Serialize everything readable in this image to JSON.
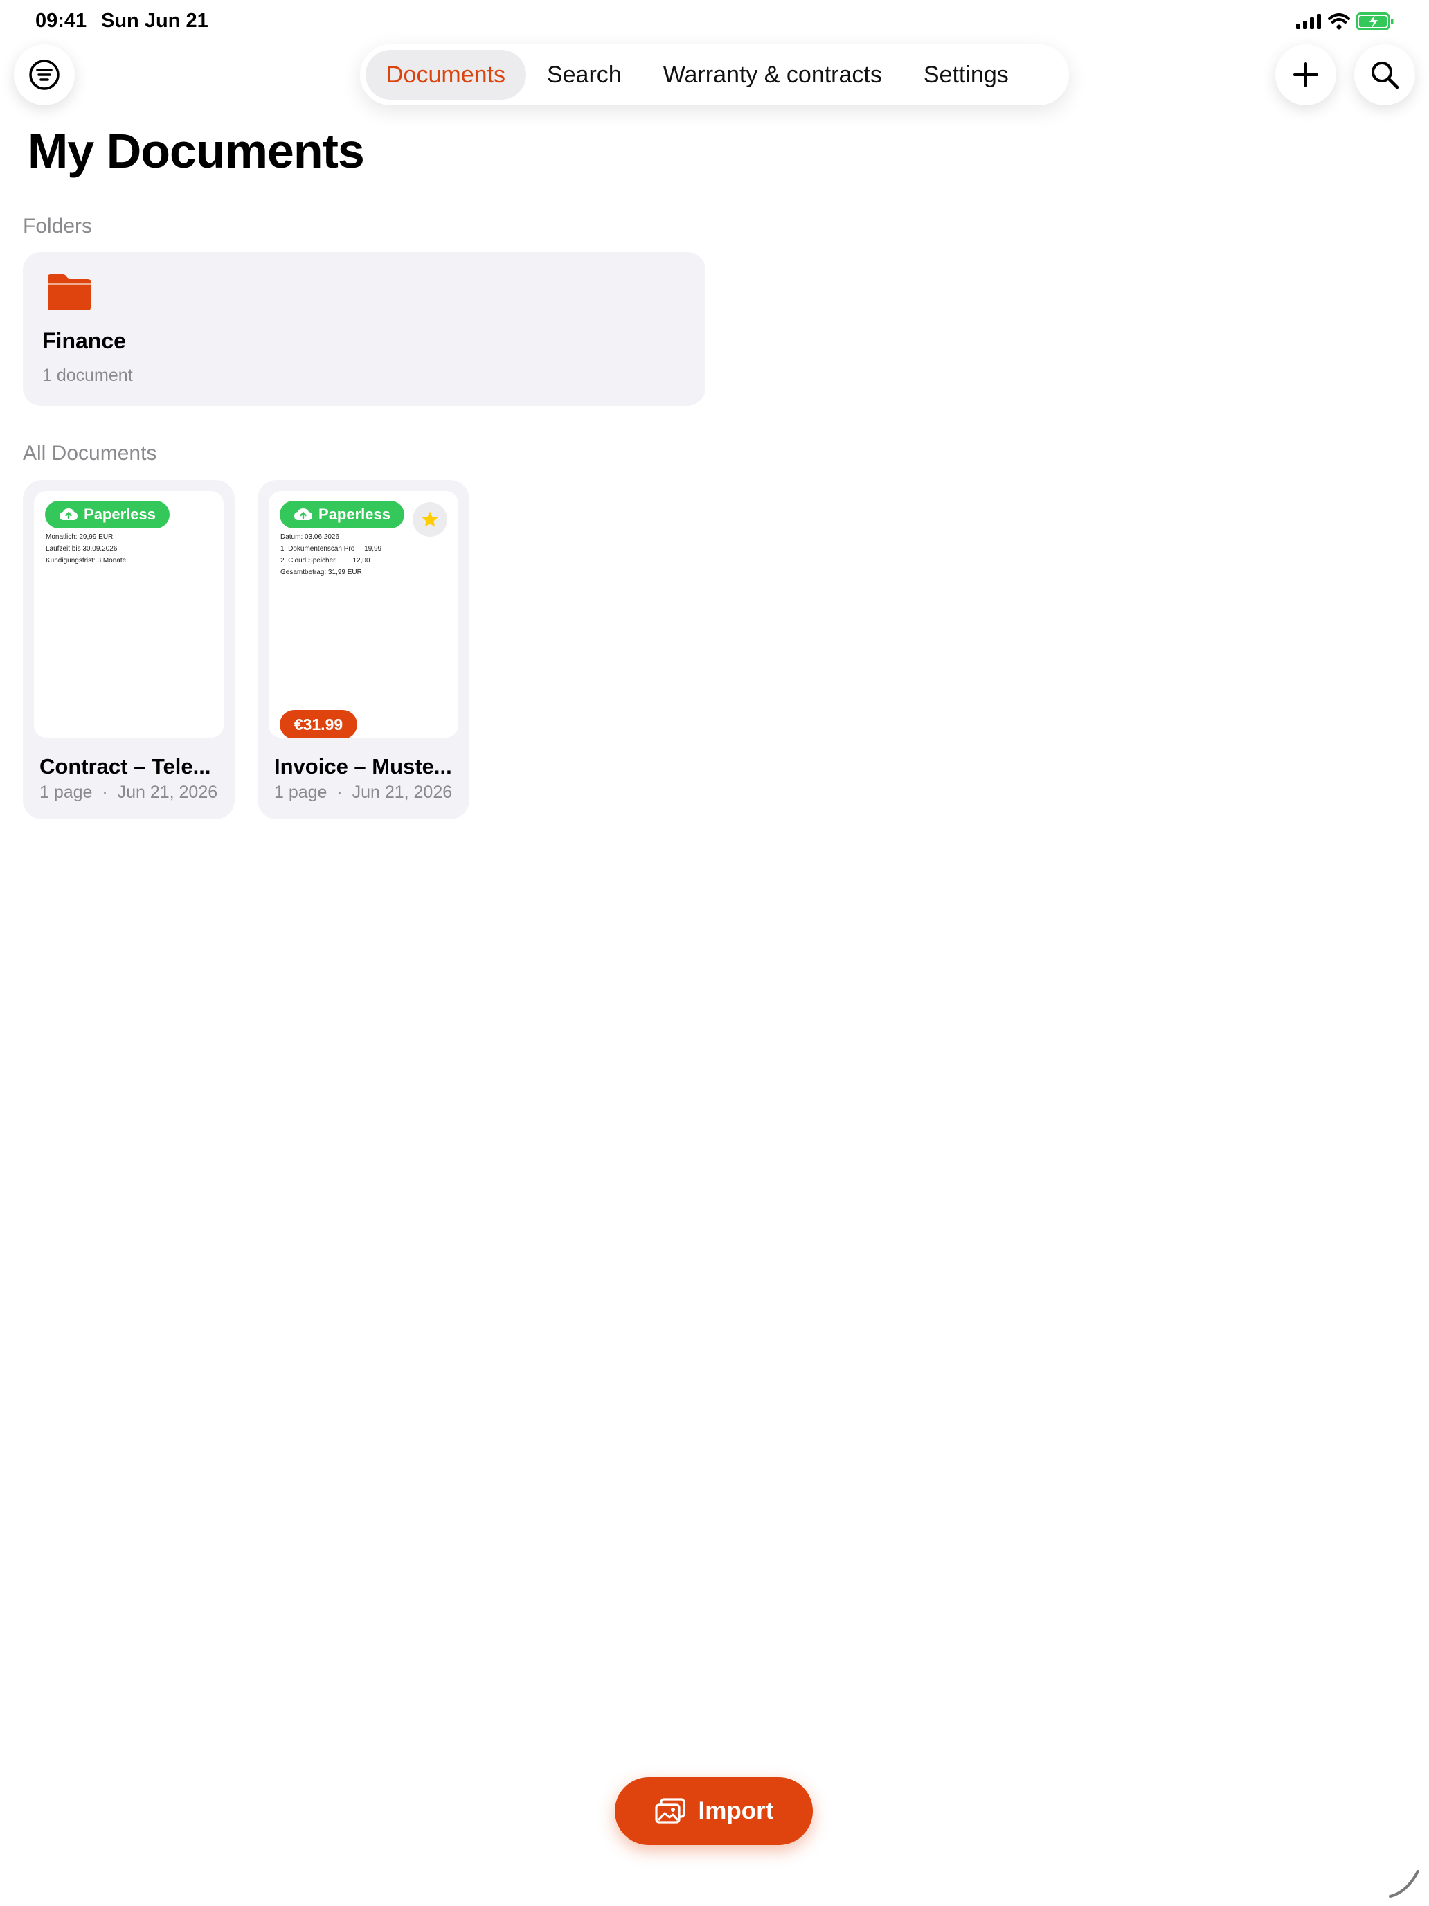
{
  "status_bar": {
    "time": "09:41",
    "date": "Sun Jun 21"
  },
  "header": {
    "menu_icon": "list-circle-icon",
    "tabs": [
      {
        "label": "Documents",
        "active": true
      },
      {
        "label": "Search",
        "active": false
      },
      {
        "label": "Warranty & contracts",
        "active": false
      },
      {
        "label": "Settings",
        "active": false
      }
    ],
    "add_icon": "plus-icon",
    "search_icon": "magnifier-icon"
  },
  "page": {
    "title": "My Documents"
  },
  "folders": {
    "section_label": "Folders",
    "items": [
      {
        "name": "Finance",
        "count": "1 document",
        "color": "#e0440e"
      }
    ]
  },
  "documents": {
    "section_label": "All Documents",
    "items": [
      {
        "title": "Contract – Tele...",
        "meta": "1 page  ·  Jun 21, 2026",
        "badge": "Paperless",
        "preview_text": "Monatlich: 29,99 EUR\nLaufzeit bis 30.09.2026\nKündigungsfrist: 3 Monate",
        "starred": false
      },
      {
        "title": "Invoice – Muste...",
        "meta": "1 page  ·  Jun 21, 2026",
        "badge": "Paperless",
        "preview_text": "Datum: 03.06.2026\n1  Dokumentenscan Pro     19,99\n2  Cloud Speicher         12,00\nGesamtbetrag: 31,99 EUR",
        "price": "€31.99",
        "starred": true
      }
    ]
  },
  "import_button": {
    "label": "Import",
    "icon": "photos-icon"
  },
  "colors": {
    "accent": "#e0440e",
    "badge_green": "#34c759",
    "card_bg": "#f2f2f7",
    "star": "#ffcc00"
  }
}
